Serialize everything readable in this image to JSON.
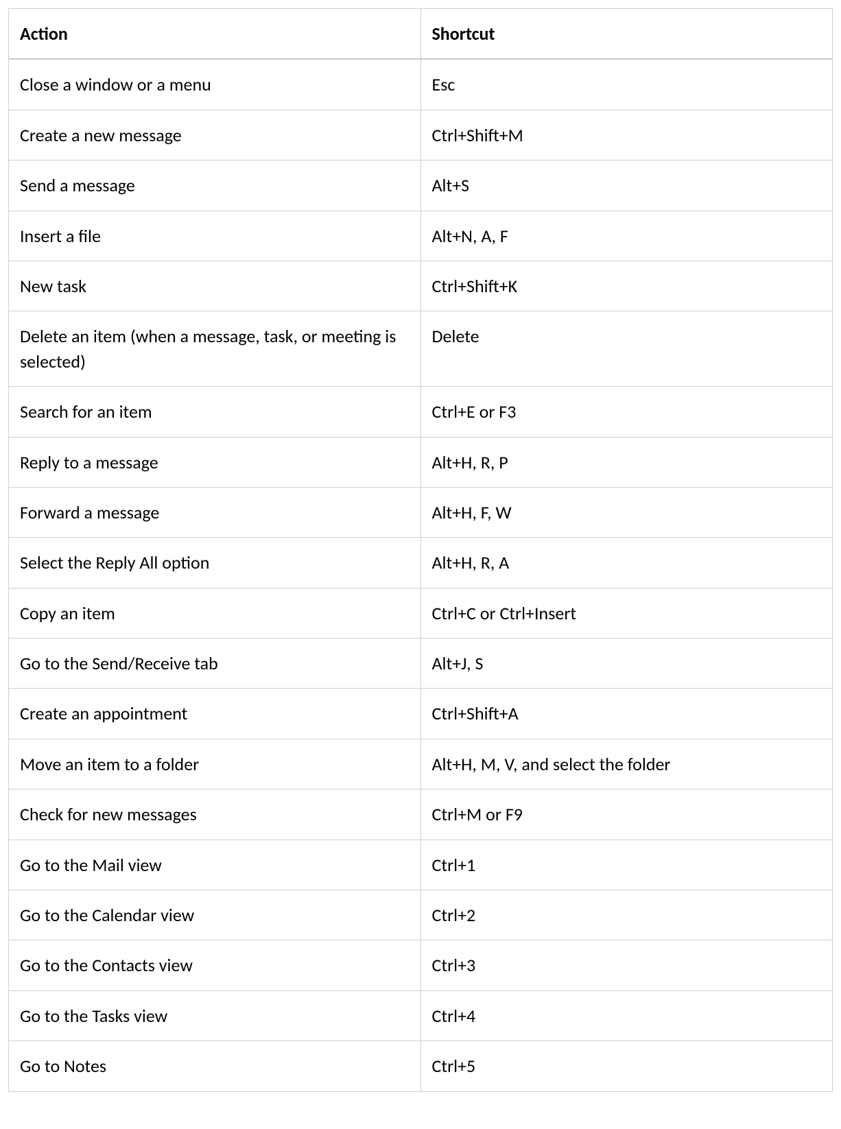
{
  "table": {
    "headers": {
      "action": "Action",
      "shortcut": "Shortcut"
    },
    "rows": [
      {
        "action": "Close a window or a menu",
        "shortcut": "Esc"
      },
      {
        "action": "Create a new message",
        "shortcut": "Ctrl+Shift+M"
      },
      {
        "action": "Send a message",
        "shortcut": "Alt+S"
      },
      {
        "action": "Insert a file",
        "shortcut": "Alt+N, A, F"
      },
      {
        "action": "New task",
        "shortcut": "Ctrl+Shift+K"
      },
      {
        "action": "Delete an item (when a message, task, or meeting is selected)",
        "shortcut": "Delete"
      },
      {
        "action": "Search for an item",
        "shortcut": "Ctrl+E or F3"
      },
      {
        "action": "Reply to a message",
        "shortcut": "Alt+H, R, P"
      },
      {
        "action": "Forward a message",
        "shortcut": "Alt+H, F, W"
      },
      {
        "action": "Select the Reply All option",
        "shortcut": "Alt+H, R, A"
      },
      {
        "action": "Copy an item",
        "shortcut": "Ctrl+C or Ctrl+Insert"
      },
      {
        "action": "Go to the Send/Receive tab",
        "shortcut": "Alt+J, S"
      },
      {
        "action": "Create an appointment",
        "shortcut": "Ctrl+Shift+A"
      },
      {
        "action": "Move an item to a folder",
        "shortcut": "Alt+H, M, V, and select the folder"
      },
      {
        "action": "Check for new messages",
        "shortcut": "Ctrl+M or F9"
      },
      {
        "action": "Go to the Mail view",
        "shortcut": "Ctrl+1"
      },
      {
        "action": "Go to the Calendar view",
        "shortcut": "Ctrl+2"
      },
      {
        "action": "Go to the Contacts view",
        "shortcut": "Ctrl+3"
      },
      {
        "action": "Go to the Tasks view",
        "shortcut": "Ctrl+4"
      },
      {
        "action": "Go to Notes",
        "shortcut": "Ctrl+5"
      }
    ]
  }
}
